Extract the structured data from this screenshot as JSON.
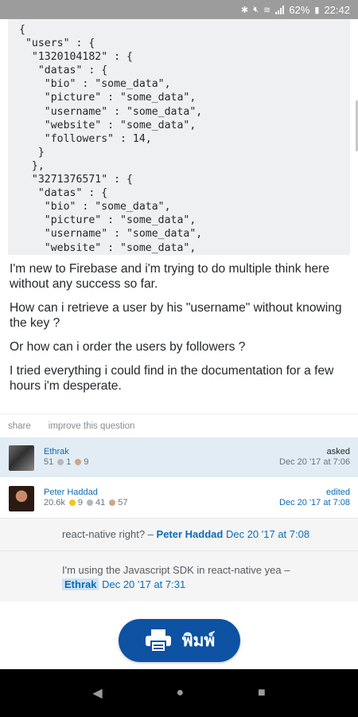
{
  "status_bar": {
    "battery": "62%",
    "time": "22:42",
    "icons": [
      "bluetooth-icon",
      "mute-icon",
      "wifi-icon",
      "signal-icon"
    ]
  },
  "code": {
    "lines": [
      "{",
      " \"users\" : {",
      "  \"1320104182\" : {",
      "   \"datas\" : {",
      "    \"bio\" : \"some_data\",",
      "    \"picture\" : \"some_data\",",
      "    \"username\" : \"some_data\",",
      "    \"website\" : \"some_data\",",
      "    \"followers\" : 14,",
      "   }",
      "  },",
      "  \"3271376571\" : {",
      "   \"datas\" : {",
      "    \"bio\" : \"some_data\",",
      "    \"picture\" : \"some_data\",",
      "    \"username\" : \"some_data\",",
      "    \"website\" : \"some_data\","
    ]
  },
  "question": {
    "paragraphs": [
      "I'm new to Firebase and i'm trying to do multiple think here without any success so far.",
      "How can i retrieve a user by his \"username\" without knowing the key ?",
      "Or how can i order the users by followers ?",
      "I tried everything i could find in the documentation for a few hours i'm desperate."
    ],
    "menu": {
      "share": "share",
      "improve": "improve this question"
    }
  },
  "asker": {
    "name": "Ethrak",
    "rep": "51",
    "silver": "1",
    "bronze": "9",
    "action": "asked",
    "time": "Dec 20 '17 at 7:06"
  },
  "editor": {
    "name": "Peter Haddad",
    "rep": "20.6k",
    "gold": "9",
    "silver": "41",
    "bronze": "57",
    "action": "edited",
    "time": "Dec 20 '17 at 7:08"
  },
  "comments": [
    {
      "text": "react-native right? –",
      "user": "Peter Haddad",
      "date": "Dec 20 '17 at 7:08"
    },
    {
      "text": "I'm using the Javascript SDK in react-native yea –",
      "user": "Ethrak",
      "date": "Dec 20 '17 at 7:31"
    }
  ],
  "print_button": {
    "label": "พิมพ์",
    "icon": "printer-icon",
    "color": "#0d52a3"
  },
  "nav_bar": {
    "icons": [
      "back-icon",
      "home-icon",
      "recents-icon"
    ]
  }
}
